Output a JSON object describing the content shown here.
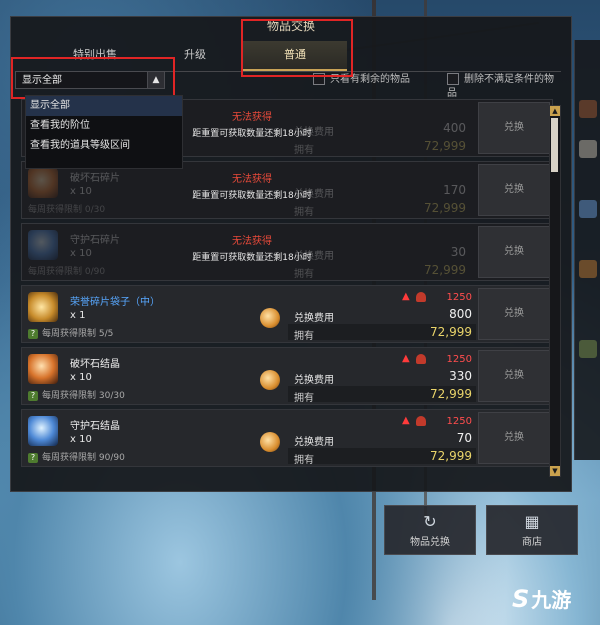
{
  "window": {
    "title": "物品交换"
  },
  "tabs": [
    {
      "label": "特别出售"
    },
    {
      "label": "升级"
    },
    {
      "label": "普通"
    }
  ],
  "filter": {
    "dropdown_value": "显示全部",
    "only_remaining_label": "只看有剩余的物品",
    "remove_unmet_label": "删除不满足条件的物品"
  },
  "dropdown_options": [
    "显示全部",
    "查看我的阶位",
    "查看我的道具等级区间"
  ],
  "rows": [
    {
      "name": "",
      "qty": "",
      "limit": "",
      "status": "无法获得",
      "reset": "距重置可获取数量还剩18小时",
      "cost_label": "兑换费用",
      "cost": "400",
      "own_label": "拥有",
      "own": "72,999",
      "button": "兑换"
    },
    {
      "name": "破坏石碎片",
      "qty": "x 10",
      "limit": "每周获得限制 0/30",
      "status": "无法获得",
      "reset": "距重置可获取数量还剩18小时",
      "cost_label": "兑换费用",
      "cost": "170",
      "own_label": "拥有",
      "own": "72,999",
      "button": "兑换"
    },
    {
      "name": "守护石碎片",
      "qty": "x 10",
      "limit": "每周获得限制 0/90",
      "status": "无法获得",
      "reset": "距重置可获取数量还剩18小时",
      "cost_label": "兑换费用",
      "cost": "30",
      "own_label": "拥有",
      "own": "72,999",
      "button": "兑换"
    },
    {
      "name": "荣誉碎片袋子（中）",
      "qty": "x 1",
      "limit": "每周获得限制 5/5",
      "level": "1250",
      "cost_label": "兑换费用",
      "cost": "800",
      "own_label": "拥有",
      "own": "72,999",
      "button": "兑换"
    },
    {
      "name": "破坏石结晶",
      "qty": "x 10",
      "limit": "每周获得限制 30/30",
      "level": "1250",
      "cost_label": "兑换费用",
      "cost": "330",
      "own_label": "拥有",
      "own": "72,999",
      "button": "兑换"
    },
    {
      "name": "守护石结晶",
      "qty": "x 10",
      "limit": "每周获得限制 90/90",
      "level": "1250",
      "cost_label": "兑换费用",
      "cost": "70",
      "own_label": "拥有",
      "own": "72,999",
      "button": "兑换"
    }
  ],
  "bottom_buttons": [
    {
      "label": "物品兑换",
      "icon": "refresh-icon"
    },
    {
      "label": "商店",
      "icon": "shop-icon"
    }
  ],
  "watermark": {
    "glyph": "S",
    "text": "九游"
  },
  "colors": {
    "accent_gold": "#c9a356",
    "unavailable_red": "#e84a3a",
    "owned_yellow": "#e9d46a",
    "highlight_box": "#e02525",
    "rare_blue": "#58a8ff"
  }
}
